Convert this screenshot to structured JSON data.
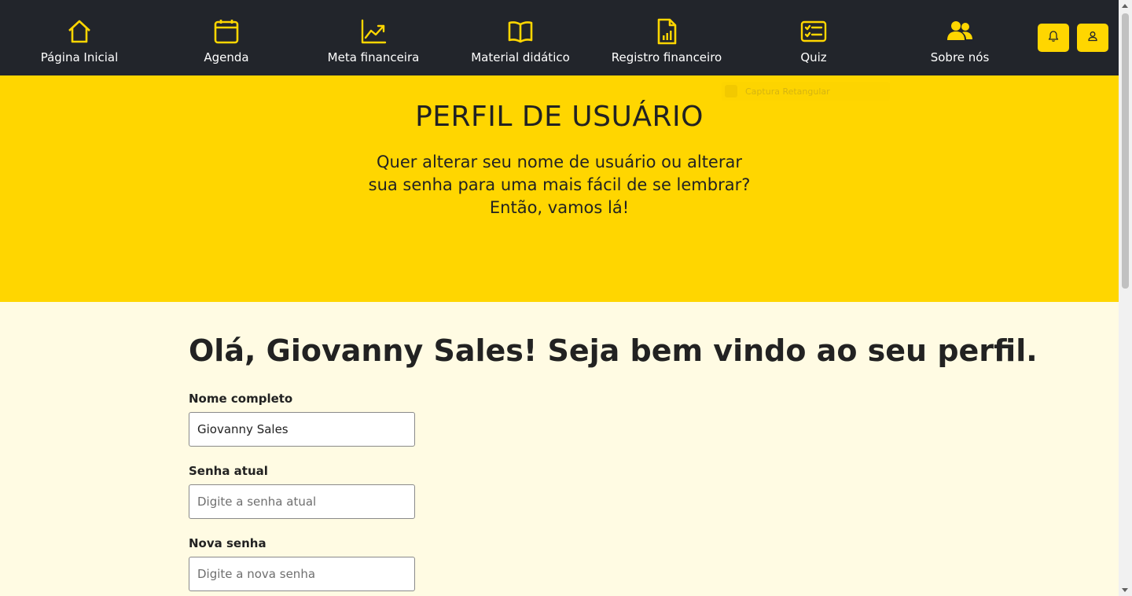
{
  "nav": {
    "items": [
      {
        "label": "Página Inicial",
        "icon": "home-icon"
      },
      {
        "label": "Agenda",
        "icon": "calendar-icon"
      },
      {
        "label": "Meta financeira",
        "icon": "trending-up-icon"
      },
      {
        "label": "Material didático",
        "icon": "book-icon"
      },
      {
        "label": "Registro financeiro",
        "icon": "report-file-icon"
      },
      {
        "label": "Quiz",
        "icon": "checklist-icon"
      },
      {
        "label": "Sobre nós",
        "icon": "people-icon"
      }
    ],
    "actions": [
      {
        "name": "notifications-button",
        "icon": "bell-icon"
      },
      {
        "name": "profile-button",
        "icon": "user-icon"
      }
    ]
  },
  "overlay": {
    "text": "Captura Retangular"
  },
  "hero": {
    "title": "PERFIL DE USUÁRIO",
    "subtitle_lines": [
      "Quer alterar seu nome de usuário ou alterar",
      "sua senha para uma mais fácil de se lembrar?",
      "Então, vamos lá!"
    ]
  },
  "profile": {
    "greeting": "Olá, Giovanny Sales! Seja bem vindo ao seu perfil.",
    "fields": [
      {
        "label": "Nome completo",
        "value": "Giovanny Sales",
        "placeholder": ""
      },
      {
        "label": "Senha atual",
        "value": "",
        "placeholder": "Digite a senha atual"
      },
      {
        "label": "Nova senha",
        "value": "",
        "placeholder": "Digite a nova senha"
      }
    ]
  },
  "colors": {
    "navbar": "#22252b",
    "accent": "#ffd600",
    "page_background": "#fffbe3",
    "text": "#222222"
  }
}
